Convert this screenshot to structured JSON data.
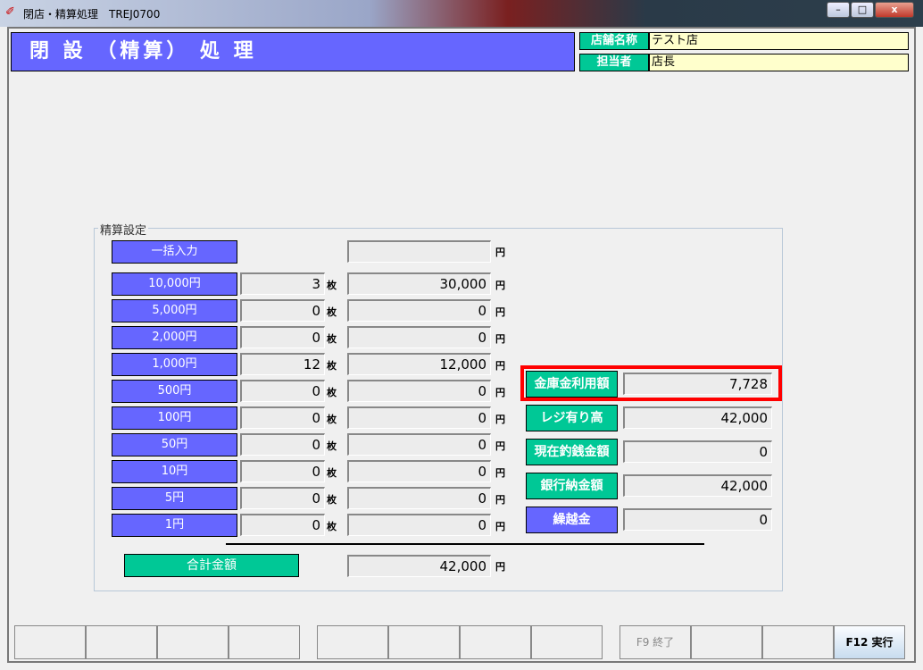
{
  "window": {
    "title": "閉店・精算処理　TREJ0700",
    "min": "–",
    "max": "□",
    "close": "x"
  },
  "header": {
    "title": "閉 設 （精算） 処 理",
    "store_label": "店舗名称",
    "store_value": "テスト店",
    "staff_label": "担当者",
    "staff_value": "店長"
  },
  "group_label": "精算設定",
  "bulk": {
    "label": "一括入力",
    "amount": "",
    "unit": "円"
  },
  "count_unit": "枚",
  "yen_unit": "円",
  "denominations": [
    {
      "label": "10,000円",
      "count": "3",
      "amount": "30,000"
    },
    {
      "label": "5,000円",
      "count": "0",
      "amount": "0"
    },
    {
      "label": "2,000円",
      "count": "0",
      "amount": "0"
    },
    {
      "label": "1,000円",
      "count": "12",
      "amount": "12,000"
    },
    {
      "label": "500円",
      "count": "0",
      "amount": "0"
    },
    {
      "label": "100円",
      "count": "0",
      "amount": "0"
    },
    {
      "label": "50円",
      "count": "0",
      "amount": "0"
    },
    {
      "label": "10円",
      "count": "0",
      "amount": "0"
    },
    {
      "label": "5円",
      "count": "0",
      "amount": "0"
    },
    {
      "label": "1円",
      "count": "0",
      "amount": "0"
    }
  ],
  "total": {
    "label": "合計金額",
    "amount": "42,000"
  },
  "summary": [
    {
      "label": "金庫金利用額",
      "value": "7,728",
      "color": "#00c896"
    },
    {
      "label": "レジ有り高",
      "value": "42,000",
      "color": "#00c896"
    },
    {
      "label": "現在釣銭金額",
      "value": "0",
      "color": "#00c896"
    },
    {
      "label": "銀行納金額",
      "value": "42,000",
      "color": "#00c896"
    },
    {
      "label": "繰越金",
      "value": "0",
      "color": "#6666ff"
    }
  ],
  "fkeys": [
    "",
    "",
    "",
    "",
    "",
    "",
    "",
    "",
    "F9 終了",
    "",
    "",
    "F12 実行"
  ]
}
